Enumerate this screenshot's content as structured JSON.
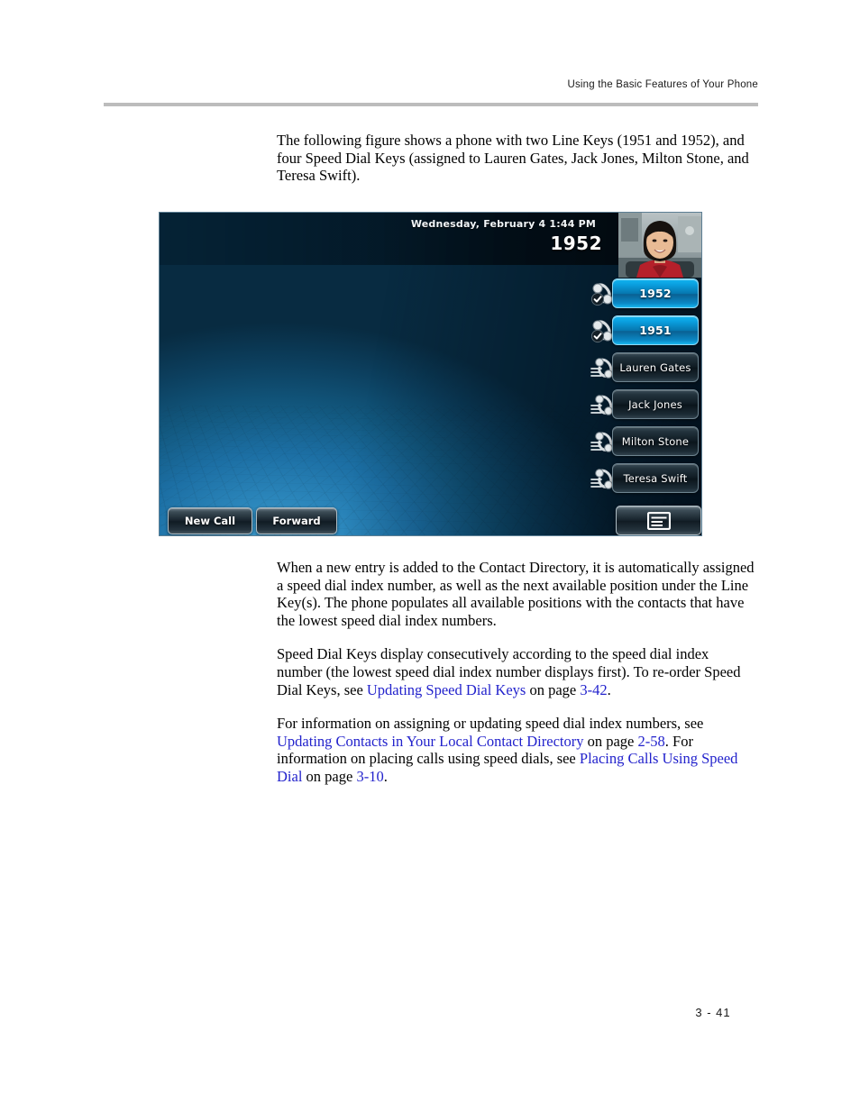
{
  "header": {
    "running_head": "Using the Basic Features of Your Phone"
  },
  "footer": {
    "page_number": "3 - 41"
  },
  "body": {
    "intro_paragraph_part1": "The following figure shows a phone with two Line Keys (1951 and 1952), and four Speed Dial Keys (assigned to Lauren Gates, Jack Jones, Milton Stone, and Teresa Swift).",
    "paragraph_2": "When a new entry is added to the Contact Directory, it is automatically assigned a speed dial index number, as well as the next available position under the Line Key(s). The phone populates all available positions with the contacts that have the lowest speed dial index numbers.",
    "paragraph_3_pre": "Speed Dial Keys display consecutively according to the speed dial index number (the lowest speed dial index number displays first). To re-order Speed Dial Keys, see ",
    "paragraph_3_link1": "Updating Speed Dial Keys",
    "paragraph_3_mid": " on page ",
    "paragraph_3_link2": "3-42",
    "paragraph_3_post": ".",
    "paragraph_4_pre": "For information on assigning or updating speed dial index numbers, see ",
    "paragraph_4_link1": "Updating Contacts in Your Local Contact Directory",
    "paragraph_4_mid1": " on page ",
    "paragraph_4_link2": "2-58",
    "paragraph_4_mid2": ". For information on placing calls using speed dials, see ",
    "paragraph_4_link3": "Placing Calls Using Speed Dial",
    "paragraph_4_mid3": " on page ",
    "paragraph_4_link4": "3-10",
    "paragraph_4_post": "."
  },
  "phone": {
    "status_bar": {
      "date_time": "Wednesday, February 4  1:44 PM",
      "line_number": "1952"
    },
    "avatar_label": "contact-photo",
    "line_keys": [
      {
        "label": "1952",
        "type": "line",
        "icon": "registered-handset-icon"
      },
      {
        "label": "1951",
        "type": "line",
        "icon": "registered-handset-icon"
      }
    ],
    "speed_dial_keys": [
      {
        "label": "Lauren Gates",
        "type": "speed-dial",
        "icon": "speed-dial-handset-icon"
      },
      {
        "label": "Jack Jones",
        "type": "speed-dial",
        "icon": "speed-dial-handset-icon"
      },
      {
        "label": "Milton Stone",
        "type": "speed-dial",
        "icon": "speed-dial-handset-icon"
      },
      {
        "label": "Teresa Swift",
        "type": "speed-dial",
        "icon": "speed-dial-handset-icon"
      }
    ],
    "soft_keys": {
      "new_call": "New Call",
      "forward": "Forward",
      "menu_icon": "menu-window-icon"
    }
  },
  "colors": {
    "link": "#2222cc",
    "rule": "#bcbcbc",
    "line_key_blue": "#0aa0e0",
    "screen_blue": "#1c6fa4",
    "speed_key_dark": "#16222b"
  }
}
